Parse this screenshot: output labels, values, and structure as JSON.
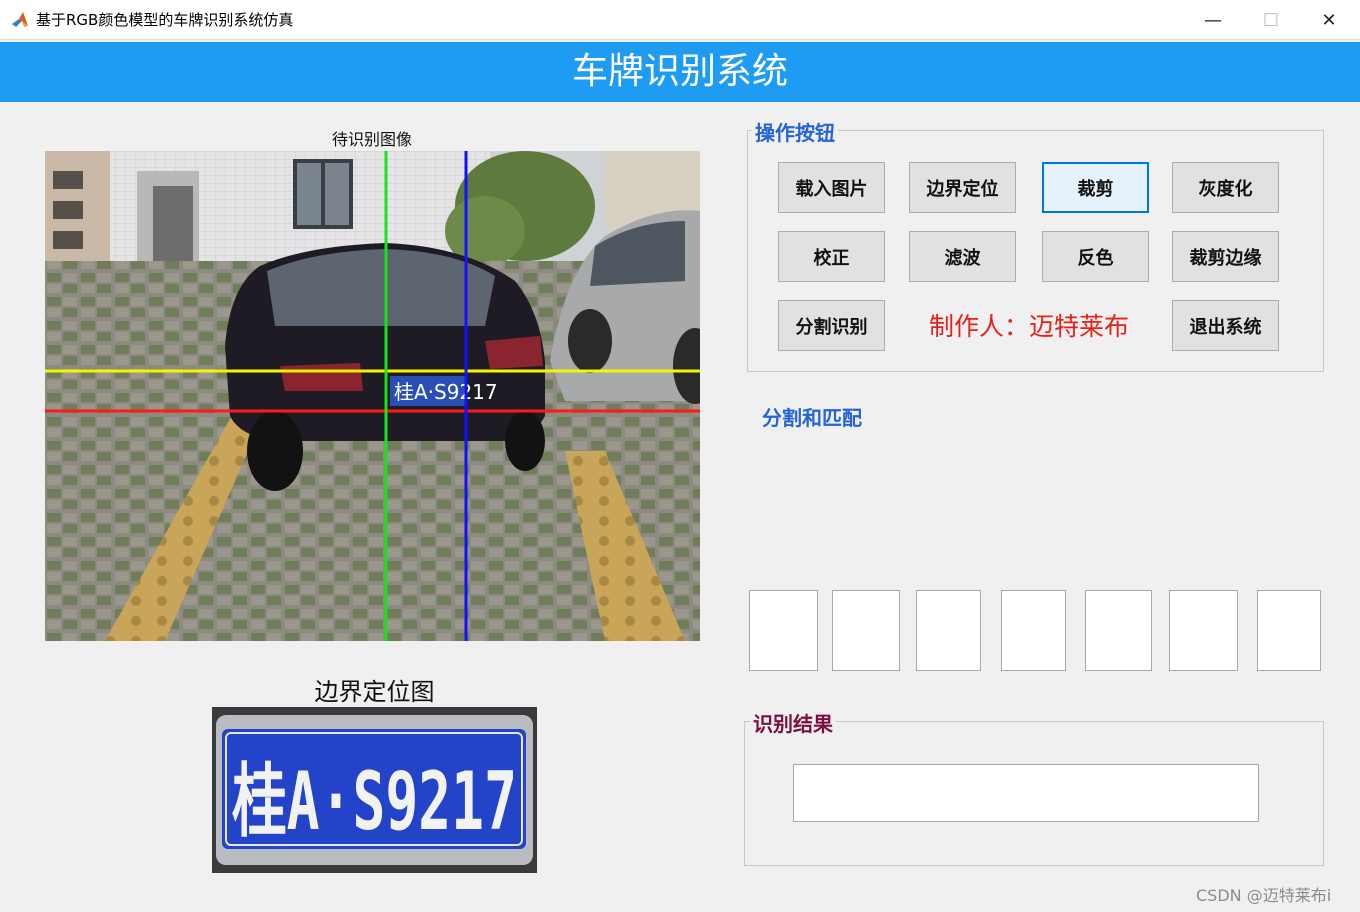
{
  "window": {
    "title": "基于RGB颜色模型的车牌识别系统仿真",
    "icon": "matlab-icon",
    "controls": {
      "minimize": "—",
      "maximize": "☐",
      "close": "✕"
    }
  },
  "banner": {
    "title": "车牌识别系统"
  },
  "images": {
    "main_caption": "待识别图像",
    "plate_caption": "边界定位图",
    "plate_text": "桂A·S9217"
  },
  "operations": {
    "title": "操作按钮",
    "buttons": [
      {
        "id": "load",
        "label": "载入图片"
      },
      {
        "id": "locate",
        "label": "边界定位"
      },
      {
        "id": "crop",
        "label": "裁剪"
      },
      {
        "id": "gray",
        "label": "灰度化"
      },
      {
        "id": "correct",
        "label": "校正"
      },
      {
        "id": "filter",
        "label": "滤波"
      },
      {
        "id": "invert",
        "label": "反色"
      },
      {
        "id": "crop-edge",
        "label": "裁剪边缘"
      },
      {
        "id": "segment",
        "label": "分割识别"
      },
      {
        "id": "exit",
        "label": "退出系统"
      }
    ],
    "maker": "制作人：迈特莱布"
  },
  "segmentation": {
    "title": "分割和匹配"
  },
  "result": {
    "title": "识别结果",
    "value": ""
  },
  "watermark": "CSDN @迈特莱布i",
  "colors": {
    "banner": "#1e9bf3",
    "accent": "#2563d6",
    "maker": "#e8201c",
    "result_title": "#7a1040"
  }
}
